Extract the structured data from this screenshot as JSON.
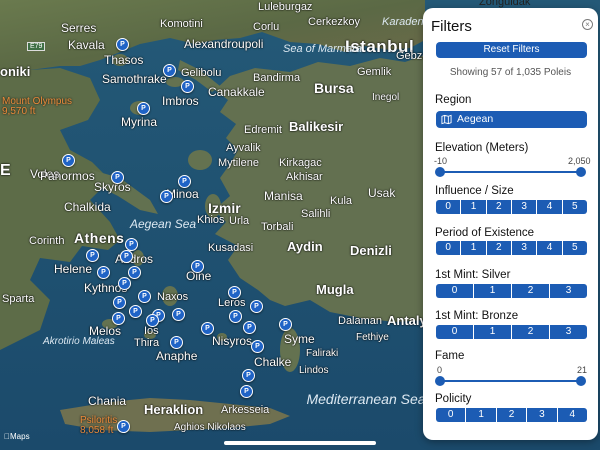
{
  "map": {
    "attribution": "Maps",
    "cities": [
      "Luleburgaz",
      "Corlu",
      "Cerkezkoy",
      "Karadeniz",
      "Serres",
      "Komotini",
      "Kavala",
      "Alexandroupoli",
      "Istanbul",
      "Thasos",
      "Gebze",
      "Samothrake",
      "Gelibolu",
      "Bandirma",
      "Gemlik",
      "Imbros",
      "Canakkale",
      "Bursa",
      "Inegol",
      "Myrina",
      "Edremit",
      "Balikesir",
      "Ayvalik",
      "Mytilene",
      "Kirkagac",
      "Volos",
      "Akhisar",
      "Panormos",
      "Skyros",
      "Minoa",
      "Manisa",
      "Usak",
      "Chalkida",
      "Izmir",
      "Kula",
      "Khios",
      "Urla",
      "Salihli",
      "Torbali",
      "Corinth",
      "Athens",
      "Kusadasi",
      "Aydin",
      "Denizli",
      "Helene",
      "Andros",
      "Oine",
      "Kythnos",
      "Naxos",
      "Leros",
      "Mugla",
      "Sparta",
      "Melos",
      "Ios",
      "Dalaman",
      "Antaly",
      "Thira",
      "Anaphe",
      "Nisyros",
      "Syme",
      "Fethiye",
      "Akrotirio Maleas",
      "Chalke",
      "Faliraki",
      "Lindos",
      "Chania",
      "Heraklion",
      "Arkesseia",
      "Aghios Nikolaos",
      "oniki",
      "E",
      "Zonguldak"
    ],
    "seas": [
      "Sea of Marmara",
      "Aegean Sea",
      "Mediterranean Sea"
    ],
    "mountains": [
      {
        "name": "Mount Olympus",
        "elev": "9,570 ft"
      },
      {
        "name": "Psiloritis",
        "elev": "8,058 ft"
      }
    ],
    "pin_glyph": "P",
    "road_shield": "E79"
  },
  "filters": {
    "title": "Filters",
    "close_icon": "close-icon",
    "reset_label": "Reset Filters",
    "showing": "Showing 57 of 1,035 Poleis",
    "region": {
      "label": "Region",
      "value": "Aegean",
      "icon": "map-icon"
    },
    "elevation": {
      "label": "Elevation (Meters)",
      "min": "-10",
      "max": "2,050"
    },
    "influence": {
      "label": "Influence / Size",
      "options": [
        "0",
        "1",
        "2",
        "3",
        "4",
        "5"
      ]
    },
    "period": {
      "label": "Period of Existence",
      "options": [
        "0",
        "1",
        "2",
        "3",
        "4",
        "5"
      ]
    },
    "mint_silver": {
      "label": "1st Mint: Silver",
      "options": [
        "0",
        "1",
        "2",
        "3"
      ]
    },
    "mint_bronze": {
      "label": "1st Mint: Bronze",
      "options": [
        "0",
        "1",
        "2",
        "3"
      ]
    },
    "fame": {
      "label": "Fame",
      "min": "0",
      "max": "21"
    },
    "policity": {
      "label": "Policity",
      "options": [
        "0",
        "1",
        "2",
        "3",
        "4"
      ]
    }
  },
  "colors": {
    "accent": "#1c5cb4",
    "pin": "#1f63c6",
    "sea": "#1c4a66",
    "land": "#5f6f4a"
  }
}
